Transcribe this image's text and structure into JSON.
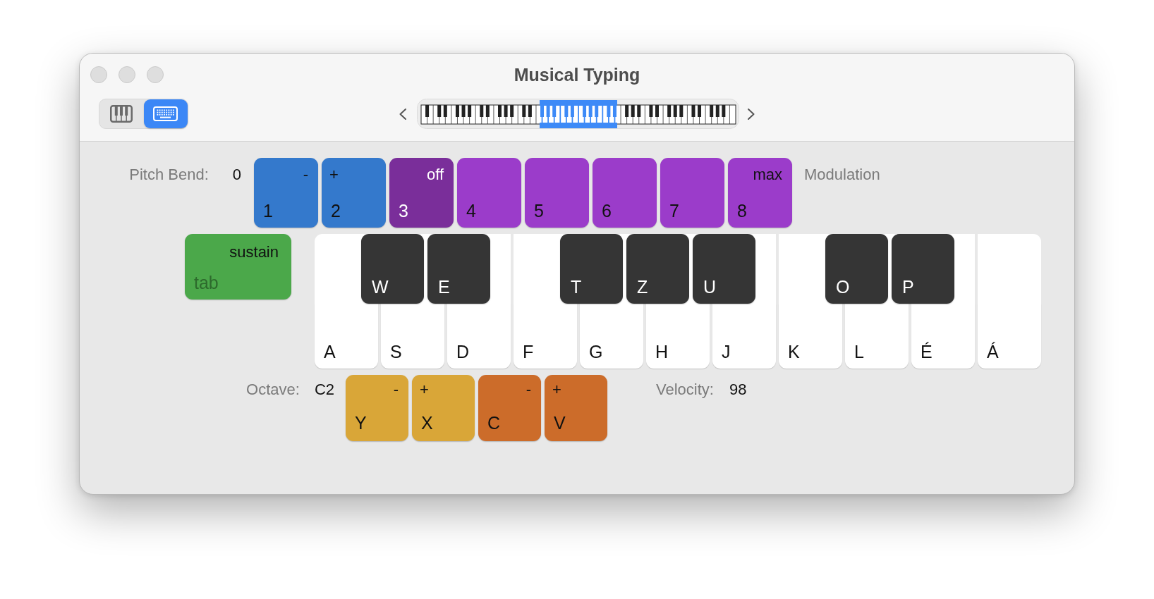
{
  "window": {
    "title": "Musical Typing"
  },
  "toolbar": {
    "view_modes": [
      {
        "kind": "piano",
        "selected": false
      },
      {
        "kind": "keyboard",
        "selected": true
      }
    ]
  },
  "pitch_bend": {
    "label": "Pitch Bend:",
    "value": "0",
    "keys": [
      {
        "key": "1",
        "label": "-",
        "kind": "decrease"
      },
      {
        "key": "2",
        "label": "+",
        "kind": "increase"
      }
    ]
  },
  "modulation": {
    "label": "Modulation",
    "keys": [
      {
        "key": "3",
        "label": "off",
        "selected": true
      },
      {
        "key": "4",
        "selected": false
      },
      {
        "key": "5",
        "selected": false
      },
      {
        "key": "6",
        "selected": false
      },
      {
        "key": "7",
        "selected": false
      },
      {
        "key": "8",
        "label": "max",
        "selected": false
      }
    ]
  },
  "sustain": {
    "key": "tab",
    "label": "sustain"
  },
  "piano_keys": [
    {
      "key": "A",
      "kind": "white"
    },
    {
      "key": "W",
      "kind": "black"
    },
    {
      "key": "S",
      "kind": "white"
    },
    {
      "key": "E",
      "kind": "black"
    },
    {
      "key": "D",
      "kind": "white"
    },
    {
      "key": "F",
      "kind": "white"
    },
    {
      "key": "T",
      "kind": "black"
    },
    {
      "key": "G",
      "kind": "white"
    },
    {
      "key": "Z",
      "kind": "black"
    },
    {
      "key": "H",
      "kind": "white"
    },
    {
      "key": "U",
      "kind": "black"
    },
    {
      "key": "J",
      "kind": "white"
    },
    {
      "key": "K",
      "kind": "white"
    },
    {
      "key": "O",
      "kind": "black"
    },
    {
      "key": "L",
      "kind": "white"
    },
    {
      "key": "P",
      "kind": "black"
    },
    {
      "key": "É",
      "kind": "white"
    },
    {
      "key": "Á",
      "kind": "white"
    }
  ],
  "octave": {
    "label": "Octave:",
    "value": "C2",
    "keys": [
      {
        "key": "Y",
        "label": "-",
        "kind": "decrease"
      },
      {
        "key": "X",
        "label": "+",
        "kind": "increase"
      }
    ]
  },
  "velocity": {
    "label": "Velocity:",
    "value": "98",
    "keys": [
      {
        "key": "C",
        "label": "-",
        "kind": "decrease"
      },
      {
        "key": "V",
        "label": "+",
        "kind": "increase"
      }
    ]
  }
}
